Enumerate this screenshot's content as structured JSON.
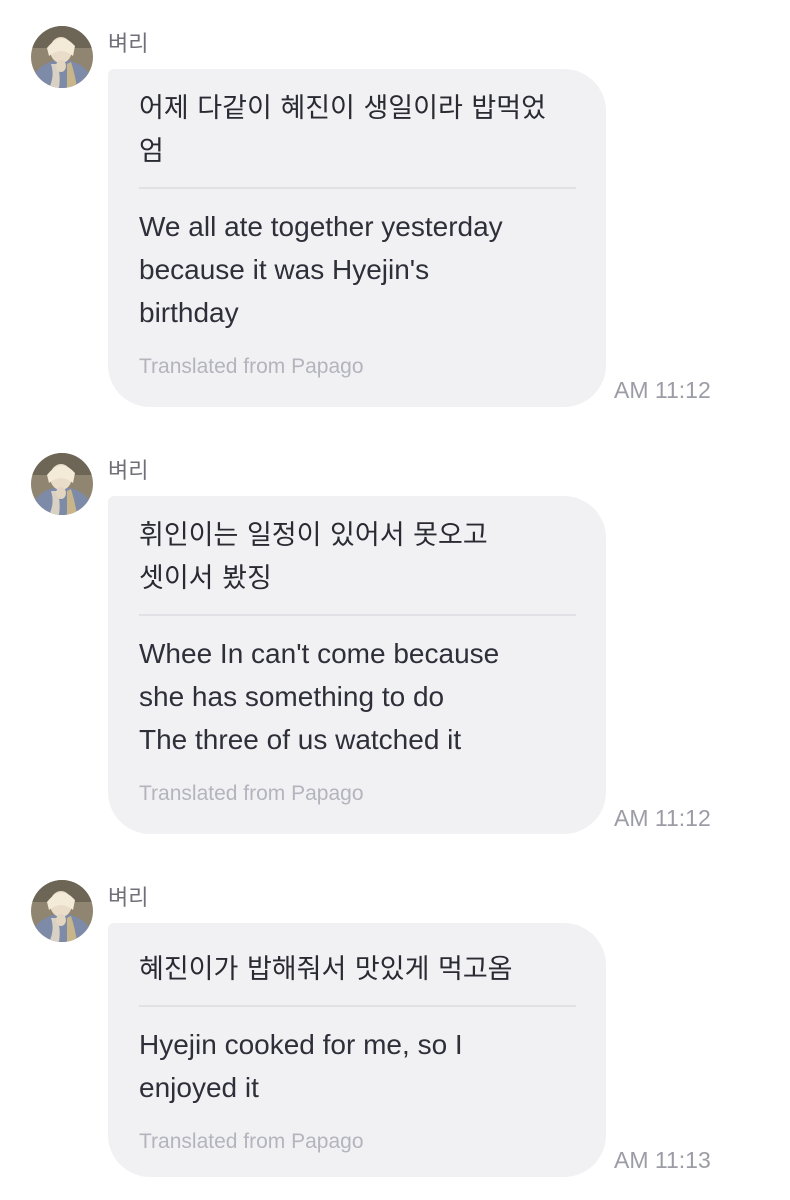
{
  "messages": [
    {
      "sender": "벼리",
      "avatar_icon": "profile-photo-icon",
      "original": "어제 다같이 혜진이 생일이라 밥먹었\n엄",
      "translation": "We all ate together yesterday\nbecause it was Hyejin's\nbirthday",
      "translated_by": "Translated from Papago",
      "time": "AM 11:12"
    },
    {
      "sender": "벼리",
      "avatar_icon": "profile-photo-icon",
      "original": "휘인이는 일정이 있어서 못오고\n셋이서 봤징",
      "translation": "Whee In can't come because\nshe has something to do\nThe three of us watched it",
      "translated_by": "Translated from Papago",
      "time": "AM 11:12"
    },
    {
      "sender": "벼리",
      "avatar_icon": "profile-photo-icon",
      "original": "혜진이가 밥해줘서 맛있게 먹고옴",
      "translation": "Hyejin cooked for me, so I\nenjoyed it",
      "translated_by": "Translated from Papago",
      "time": "AM 11:13"
    }
  ],
  "colors": {
    "background": "#ffffff",
    "bubble": "#f1f1f4",
    "divider": "#e0e0e5",
    "text": "#2a2a33",
    "secondary_text": "#b4b4bd",
    "timestamp": "#9c9ca6"
  }
}
